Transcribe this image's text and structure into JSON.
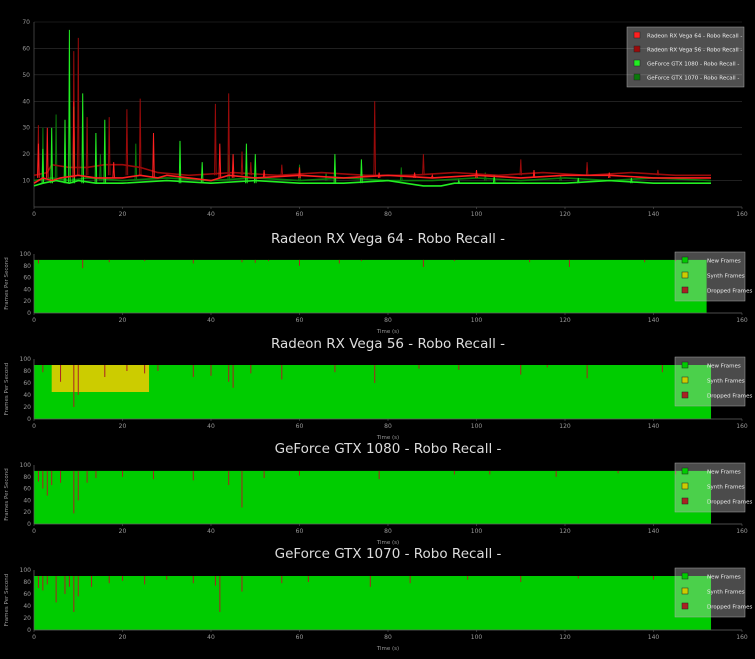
{
  "chart_data": [
    {
      "type": "line",
      "xlim": [
        0,
        160
      ],
      "ylim": [
        0,
        70
      ],
      "x_ticks": [
        "0",
        "20",
        "40",
        "60",
        "80",
        "100",
        "120",
        "140",
        "160"
      ],
      "y_ticks": [
        "10",
        "20",
        "30",
        "40",
        "50",
        "60",
        "70"
      ],
      "legend_position": "top-right",
      "series": [
        {
          "name": "Radeon RX Vega 64 - Robo Recall -",
          "color": "#ff2020",
          "baseline": 11,
          "points": [
            [
              0,
              9
            ],
            [
              2,
              11
            ],
            [
              4,
              10
            ],
            [
              6,
              11
            ],
            [
              10,
              12
            ],
            [
              14,
              11
            ],
            [
              20,
              11
            ],
            [
              24,
              12
            ],
            [
              28,
              11
            ],
            [
              30,
              12
            ],
            [
              40,
              10
            ],
            [
              44,
              12
            ],
            [
              50,
              11
            ],
            [
              60,
              12
            ],
            [
              70,
              11
            ],
            [
              80,
              12
            ],
            [
              90,
              11
            ],
            [
              100,
              12
            ],
            [
              110,
              11
            ],
            [
              120,
              12
            ],
            [
              130,
              12
            ],
            [
              140,
              11
            ],
            [
              153,
              11
            ]
          ],
          "spikes": [
            [
              1,
              24
            ],
            [
              3,
              30
            ],
            [
              9,
              40
            ],
            [
              18,
              17
            ],
            [
              27,
              28
            ],
            [
              42,
              24
            ],
            [
              45,
              20
            ],
            [
              52,
              14
            ],
            [
              60,
              15
            ],
            [
              78,
              13
            ],
            [
              86,
              13
            ],
            [
              90,
              12
            ],
            [
              100,
              14
            ],
            [
              113,
              14
            ],
            [
              130,
              13
            ]
          ]
        },
        {
          "name": "Radeon RX Vega 56 - Robo Recall -",
          "color": "#9a0a0a",
          "baseline": 12,
          "points": [
            [
              0,
              12
            ],
            [
              3,
              13
            ],
            [
              4,
              16
            ],
            [
              8,
              15
            ],
            [
              12,
              15
            ],
            [
              16,
              16
            ],
            [
              20,
              16
            ],
            [
              24,
              15
            ],
            [
              26,
              14
            ],
            [
              28,
              13
            ],
            [
              35,
              12
            ],
            [
              45,
              13
            ],
            [
              55,
              12
            ],
            [
              65,
              13
            ],
            [
              75,
              12
            ],
            [
              85,
              12
            ],
            [
              95,
              13
            ],
            [
              105,
              12
            ],
            [
              115,
              13
            ],
            [
              125,
              12
            ],
            [
              135,
              13
            ],
            [
              145,
              12
            ],
            [
              153,
              12
            ]
          ],
          "spikes": [
            [
              1,
              31
            ],
            [
              9,
              59
            ],
            [
              10,
              64
            ],
            [
              12,
              34
            ],
            [
              17,
              34
            ],
            [
              21,
              37
            ],
            [
              24,
              41
            ],
            [
              41,
              39
            ],
            [
              44,
              43
            ],
            [
              47,
              21
            ],
            [
              49,
              17
            ],
            [
              56,
              16
            ],
            [
              77,
              40
            ],
            [
              88,
              20
            ],
            [
              110,
              18
            ],
            [
              125,
              17
            ],
            [
              141,
              14
            ]
          ]
        },
        {
          "name": "GeForce GTX 1080 - Robo Recall -",
          "color": "#22ee22",
          "baseline": 9,
          "points": [
            [
              0,
              8
            ],
            [
              2,
              9
            ],
            [
              5,
              10
            ],
            [
              8,
              9
            ],
            [
              10,
              10
            ],
            [
              14,
              9
            ],
            [
              20,
              9
            ],
            [
              30,
              10
            ],
            [
              40,
              9
            ],
            [
              50,
              10
            ],
            [
              60,
              9
            ],
            [
              70,
              9
            ],
            [
              80,
              10
            ],
            [
              88,
              8
            ],
            [
              92,
              8
            ],
            [
              95,
              9
            ],
            [
              100,
              9
            ],
            [
              110,
              9
            ],
            [
              120,
              9
            ],
            [
              130,
              10
            ],
            [
              140,
              9
            ],
            [
              145,
              9
            ],
            [
              153,
              9
            ]
          ],
          "spikes": [
            [
              2,
              22
            ],
            [
              4,
              30
            ],
            [
              7,
              33
            ],
            [
              8,
              67
            ],
            [
              9,
              38
            ],
            [
              11,
              43
            ],
            [
              14,
              28
            ],
            [
              16,
              33
            ],
            [
              33,
              25
            ],
            [
              38,
              17
            ],
            [
              48,
              24
            ],
            [
              50,
              20
            ],
            [
              68,
              20
            ],
            [
              74,
              18
            ],
            [
              96,
              10
            ],
            [
              104,
              12
            ],
            [
              123,
              11
            ],
            [
              135,
              11
            ]
          ]
        },
        {
          "name": "GeForce GTX 1070 - Robo Recall -",
          "color": "#0a7a0a",
          "baseline": 10,
          "points": [
            [
              0,
              10
            ],
            [
              4,
              11
            ],
            [
              8,
              10
            ],
            [
              12,
              11
            ],
            [
              20,
              10
            ],
            [
              30,
              11
            ],
            [
              40,
              10
            ],
            [
              50,
              11
            ],
            [
              60,
              10
            ],
            [
              70,
              11
            ],
            [
              80,
              10
            ],
            [
              90,
              10
            ],
            [
              100,
              11
            ],
            [
              110,
              10
            ],
            [
              120,
              11
            ],
            [
              130,
              10
            ],
            [
              140,
              11
            ],
            [
              153,
              10
            ]
          ],
          "spikes": [
            [
              2,
              30
            ],
            [
              5,
              35
            ],
            [
              7,
              25
            ],
            [
              15,
              20
            ],
            [
              23,
              24
            ],
            [
              44,
              20
            ],
            [
              60,
              16
            ],
            [
              66,
              13
            ],
            [
              83,
              15
            ],
            [
              102,
              13
            ],
            [
              119,
              12
            ]
          ]
        }
      ]
    },
    {
      "type": "area",
      "title": "Radeon RX Vega 64 - Robo Recall -",
      "xlabel": "Time (s)",
      "ylabel": "Frames Per Second",
      "xlim": [
        0,
        160
      ],
      "ylim": [
        0,
        100
      ],
      "x_ticks": [
        "0",
        "20",
        "40",
        "60",
        "80",
        "100",
        "120",
        "140",
        "160"
      ],
      "y_ticks": [
        "0",
        "20",
        "40",
        "60",
        "80",
        "100"
      ],
      "end_time": 152,
      "series": [
        {
          "name": "New Frames",
          "color": "#00cc00",
          "level": 90
        },
        {
          "name": "Synth Frames",
          "color": "#cccc00",
          "segments": []
        },
        {
          "name": "Dropped Frames",
          "color": "#aa2222"
        }
      ],
      "dips": [
        [
          1,
          84
        ],
        [
          11,
          76
        ],
        [
          17,
          86
        ],
        [
          25,
          88
        ],
        [
          36,
          84
        ],
        [
          47,
          86
        ],
        [
          50,
          85
        ],
        [
          53,
          88
        ],
        [
          60,
          80
        ],
        [
          69,
          84
        ],
        [
          74,
          88
        ],
        [
          88,
          78
        ],
        [
          95,
          88
        ],
        [
          112,
          86
        ],
        [
          121,
          78
        ],
        [
          138,
          86
        ],
        [
          145,
          88
        ]
      ],
      "legend": [
        "New Frames",
        "Synth Frames",
        "Dropped Frames"
      ]
    },
    {
      "type": "area",
      "title": "Radeon RX Vega 56 - Robo Recall -",
      "xlabel": "Time (s)",
      "ylabel": "Frames Per Second",
      "xlim": [
        0,
        160
      ],
      "ylim": [
        0,
        100
      ],
      "x_ticks": [
        "0",
        "20",
        "40",
        "60",
        "80",
        "100",
        "120",
        "140",
        "160"
      ],
      "y_ticks": [
        "0",
        "20",
        "40",
        "60",
        "80",
        "100"
      ],
      "end_time": 153,
      "series": [
        {
          "name": "New Frames",
          "color": "#00cc00",
          "level": 90
        },
        {
          "name": "Synth Frames",
          "color": "#cccc00",
          "segments": [
            [
              4,
              26,
              45
            ]
          ]
        },
        {
          "name": "Dropped Frames",
          "color": "#aa2222"
        }
      ],
      "dips": [
        [
          2,
          78
        ],
        [
          6,
          62
        ],
        [
          9,
          20
        ],
        [
          10,
          40
        ],
        [
          16,
          70
        ],
        [
          21,
          80
        ],
        [
          25,
          76
        ],
        [
          28,
          80
        ],
        [
          36,
          70
        ],
        [
          40,
          72
        ],
        [
          44,
          62
        ],
        [
          45,
          52
        ],
        [
          49,
          76
        ],
        [
          56,
          66
        ],
        [
          68,
          78
        ],
        [
          77,
          60
        ],
        [
          87,
          84
        ],
        [
          96,
          82
        ],
        [
          110,
          74
        ],
        [
          116,
          86
        ],
        [
          125,
          68
        ],
        [
          142,
          78
        ]
      ],
      "legend": [
        "New Frames",
        "Synth Frames",
        "Dropped Frames"
      ]
    },
    {
      "type": "area",
      "title": "GeForce GTX 1080 - Robo Recall -",
      "xlabel": "Time (s)",
      "ylabel": "Frames Per Second",
      "xlim": [
        0,
        160
      ],
      "ylim": [
        0,
        100
      ],
      "x_ticks": [
        "0",
        "20",
        "40",
        "60",
        "80",
        "100",
        "120",
        "140",
        "160"
      ],
      "y_ticks": [
        "0",
        "20",
        "40",
        "60",
        "80",
        "100"
      ],
      "end_time": 153,
      "series": [
        {
          "name": "New Frames",
          "color": "#00cc00",
          "level": 90
        },
        {
          "name": "Synth Frames",
          "color": "#cccc00",
          "segments": []
        },
        {
          "name": "Dropped Frames",
          "color": "#aa2222"
        }
      ],
      "dips": [
        [
          1,
          72
        ],
        [
          2,
          60
        ],
        [
          3,
          48
        ],
        [
          4,
          66
        ],
        [
          6,
          70
        ],
        [
          9,
          18
        ],
        [
          10,
          40
        ],
        [
          12,
          70
        ],
        [
          14,
          78
        ],
        [
          20,
          80
        ],
        [
          27,
          76
        ],
        [
          36,
          74
        ],
        [
          44,
          66
        ],
        [
          47,
          28
        ],
        [
          52,
          78
        ],
        [
          60,
          82
        ],
        [
          78,
          76
        ],
        [
          95,
          84
        ],
        [
          103,
          84
        ],
        [
          118,
          80
        ],
        [
          132,
          86
        ],
        [
          145,
          84
        ]
      ],
      "legend": [
        "New Frames",
        "Synth Frames",
        "Dropped Frames"
      ]
    },
    {
      "type": "area",
      "title": "GeForce GTX 1070 - Robo Recall -",
      "xlabel": "Time (s)",
      "ylabel": "Frames Per Second",
      "xlim": [
        0,
        160
      ],
      "ylim": [
        0,
        100
      ],
      "x_ticks": [
        "0",
        "20",
        "40",
        "60",
        "80",
        "100",
        "120",
        "140",
        "160"
      ],
      "y_ticks": [
        "0",
        "20",
        "40",
        "60",
        "80",
        "100"
      ],
      "end_time": 153,
      "series": [
        {
          "name": "New Frames",
          "color": "#00cc00",
          "level": 90
        },
        {
          "name": "Synth Frames",
          "color": "#cccc00",
          "segments": []
        },
        {
          "name": "Dropped Frames",
          "color": "#aa2222"
        }
      ],
      "dips": [
        [
          1,
          70
        ],
        [
          2,
          66
        ],
        [
          3,
          76
        ],
        [
          5,
          46
        ],
        [
          7,
          60
        ],
        [
          8,
          72
        ],
        [
          9,
          30
        ],
        [
          10,
          56
        ],
        [
          13,
          72
        ],
        [
          17,
          78
        ],
        [
          20,
          82
        ],
        [
          25,
          76
        ],
        [
          30,
          84
        ],
        [
          36,
          78
        ],
        [
          41,
          74
        ],
        [
          42,
          30
        ],
        [
          47,
          64
        ],
        [
          56,
          78
        ],
        [
          62,
          80
        ],
        [
          76,
          72
        ],
        [
          85,
          78
        ],
        [
          98,
          84
        ],
        [
          110,
          80
        ],
        [
          123,
          86
        ],
        [
          140,
          84
        ]
      ],
      "legend": [
        "New Frames",
        "Synth Frames",
        "Dropped Frames"
      ]
    }
  ]
}
